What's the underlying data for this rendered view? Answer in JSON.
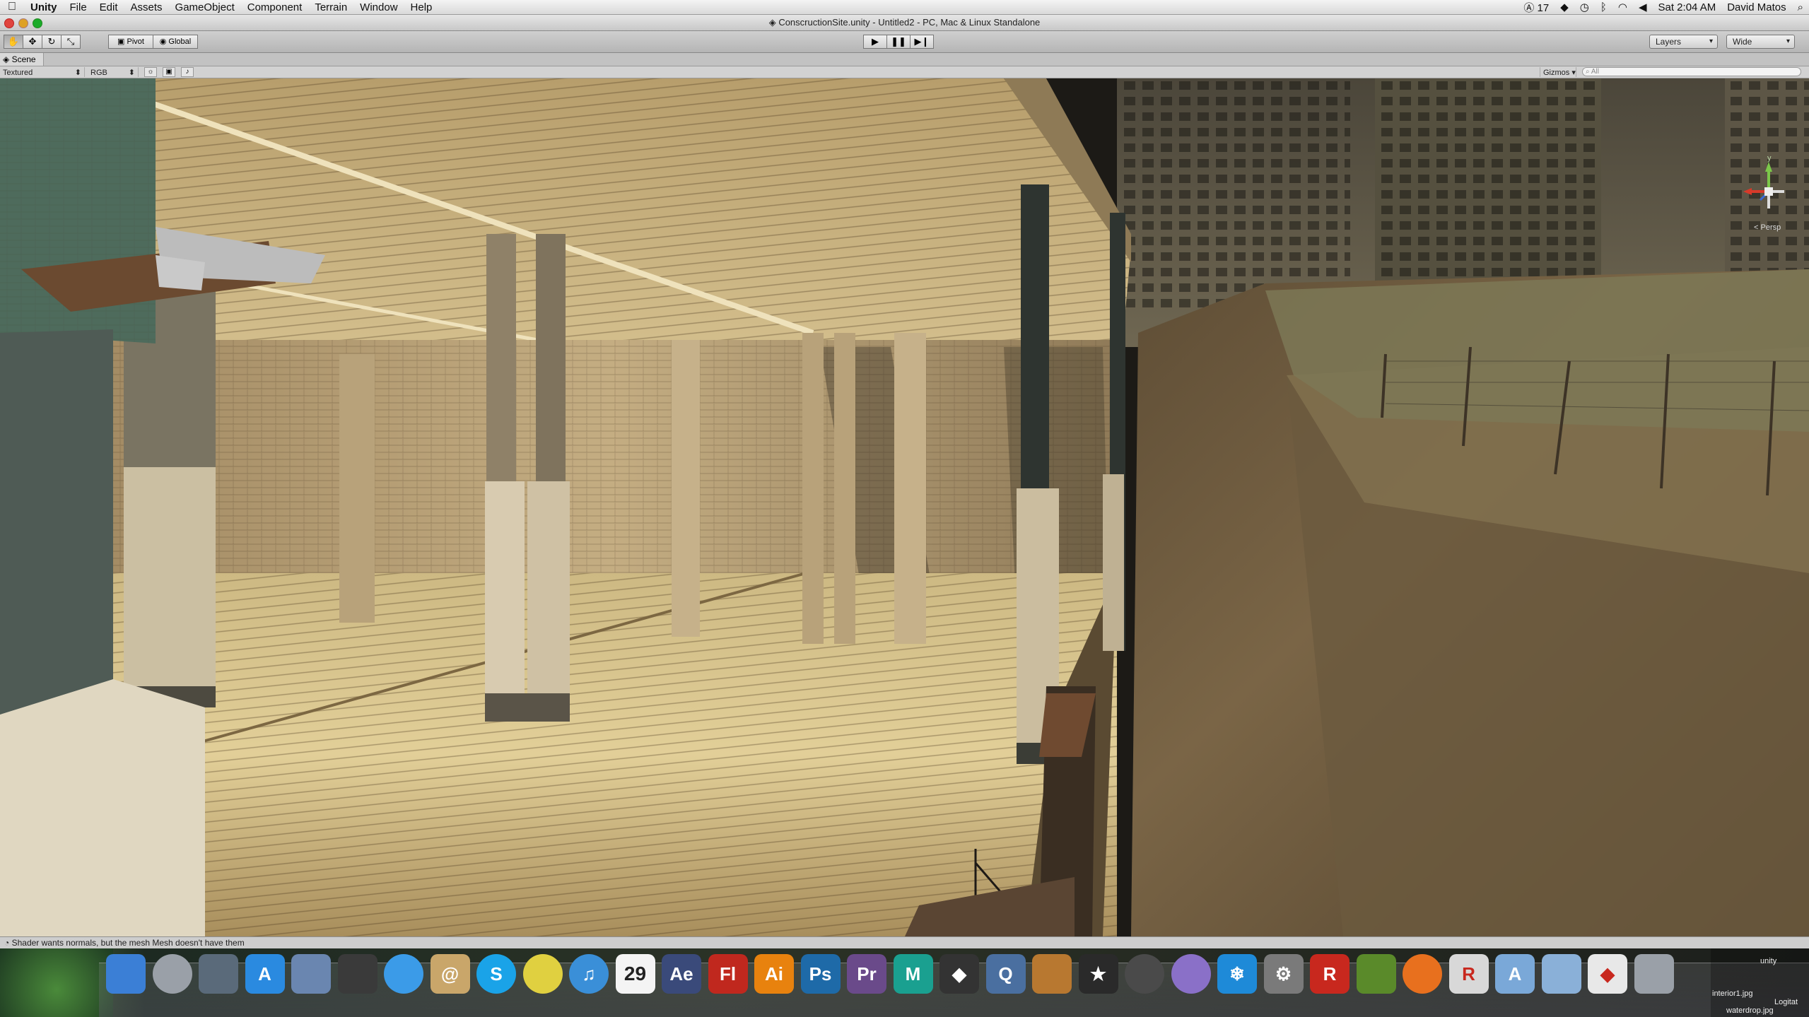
{
  "menubar": {
    "items": [
      "Unity",
      "File",
      "Edit",
      "Assets",
      "GameObject",
      "Component",
      "Terrain",
      "Window",
      "Help"
    ],
    "status": {
      "adobe_count": "17",
      "clock": "Sat 2:04 AM",
      "user": "David Matos"
    }
  },
  "window": {
    "title": "ConscructionSite.unity - Untitled2 - PC, Mac & Linux Standalone"
  },
  "toolbar": {
    "pivot_label": "Pivot",
    "global_label": "Global",
    "layers_label": "Layers",
    "layout_label": "Wide"
  },
  "scene": {
    "tab_label": "Scene",
    "render_mode": "Textured",
    "color_mode": "RGB",
    "gizmos_label": "Gizmos",
    "search_placeholder": "All",
    "persp_label": "Persp",
    "axis_y": "y"
  },
  "status": {
    "message": "Shader wants normals, but the mesh Mesh doesn't have them"
  },
  "dock": {
    "calendar_day": "29",
    "icons": [
      {
        "name": "finder-icon",
        "label": "",
        "bg": "#3b7fd6"
      },
      {
        "name": "launchpad-icon",
        "label": "",
        "bg": "#9aa0a8"
      },
      {
        "name": "mission-control-icon",
        "label": "",
        "bg": "#5a6a7a"
      },
      {
        "name": "app-store-icon",
        "label": "A",
        "bg": "#2a8ae0"
      },
      {
        "name": "preview-icon",
        "label": "",
        "bg": "#6a86b0"
      },
      {
        "name": "pencil-app-icon",
        "label": "",
        "bg": "#3a3a3a"
      },
      {
        "name": "safari-icon",
        "label": "",
        "bg": "#3b9be8"
      },
      {
        "name": "address-book-icon",
        "label": "@",
        "bg": "#c9a66a"
      },
      {
        "name": "skype-icon",
        "label": "S",
        "bg": "#1aa3e8"
      },
      {
        "name": "chrome-icon",
        "label": "",
        "bg": "#e0d040"
      },
      {
        "name": "itunes-icon",
        "label": "♫",
        "bg": "#3a8fd8"
      },
      {
        "name": "calendar-icon",
        "label": "",
        "bg": "#f4f4f4"
      },
      {
        "name": "after-effects-icon",
        "label": "Ae",
        "bg": "#3a4a7a"
      },
      {
        "name": "flash-icon",
        "label": "Fl",
        "bg": "#c0281e"
      },
      {
        "name": "illustrator-icon",
        "label": "Ai",
        "bg": "#e8820e"
      },
      {
        "name": "photoshop-icon",
        "label": "Ps",
        "bg": "#1e6aa8"
      },
      {
        "name": "premiere-icon",
        "label": "Pr",
        "bg": "#6a4a8a"
      },
      {
        "name": "maya-icon",
        "label": "M",
        "bg": "#1aa090"
      },
      {
        "name": "unity-icon",
        "label": "◆",
        "bg": "#333333"
      },
      {
        "name": "quicktime-icon",
        "label": "Q",
        "bg": "#4a6fa0"
      },
      {
        "name": "garageband-icon",
        "label": "",
        "bg": "#b87830"
      },
      {
        "name": "imovie-icon",
        "label": "★",
        "bg": "#2a2a2a"
      },
      {
        "name": "steam-icon",
        "label": "",
        "bg": "#4a4a4a"
      },
      {
        "name": "purple-orb-icon",
        "label": "",
        "bg": "#8a70c8"
      },
      {
        "name": "snowflake-icon",
        "label": "❄",
        "bg": "#1e8ad8"
      },
      {
        "name": "system-preferences-icon",
        "label": "⚙",
        "bg": "#7a7a7a"
      },
      {
        "name": "roblox-studio-icon",
        "label": "R",
        "bg": "#c8281e"
      },
      {
        "name": "minecraft-icon",
        "label": "",
        "bg": "#5a8a2a"
      },
      {
        "name": "firefox-icon",
        "label": "",
        "bg": "#e8701e"
      },
      {
        "name": "roblox-icon",
        "label": "R",
        "bg": "#d8d8d8"
      },
      {
        "name": "applications-folder-icon",
        "label": "A",
        "bg": "#7aa8d8"
      },
      {
        "name": "documents-folder-icon",
        "label": "",
        "bg": "#8ab0d8"
      },
      {
        "name": "unity-folder-icon",
        "label": "◆",
        "bg": "#e8e8e8"
      },
      {
        "name": "trash-icon",
        "label": "",
        "bg": "#9aa0a8"
      }
    ],
    "file_labels": [
      "unity",
      "interior1.jpg",
      "Logitat",
      "waterdrop.jpg"
    ]
  },
  "colors": {
    "accent": "#3b7fd6",
    "viewport_floor": "#d6c08a",
    "sky_building": "#5e5a4c"
  }
}
